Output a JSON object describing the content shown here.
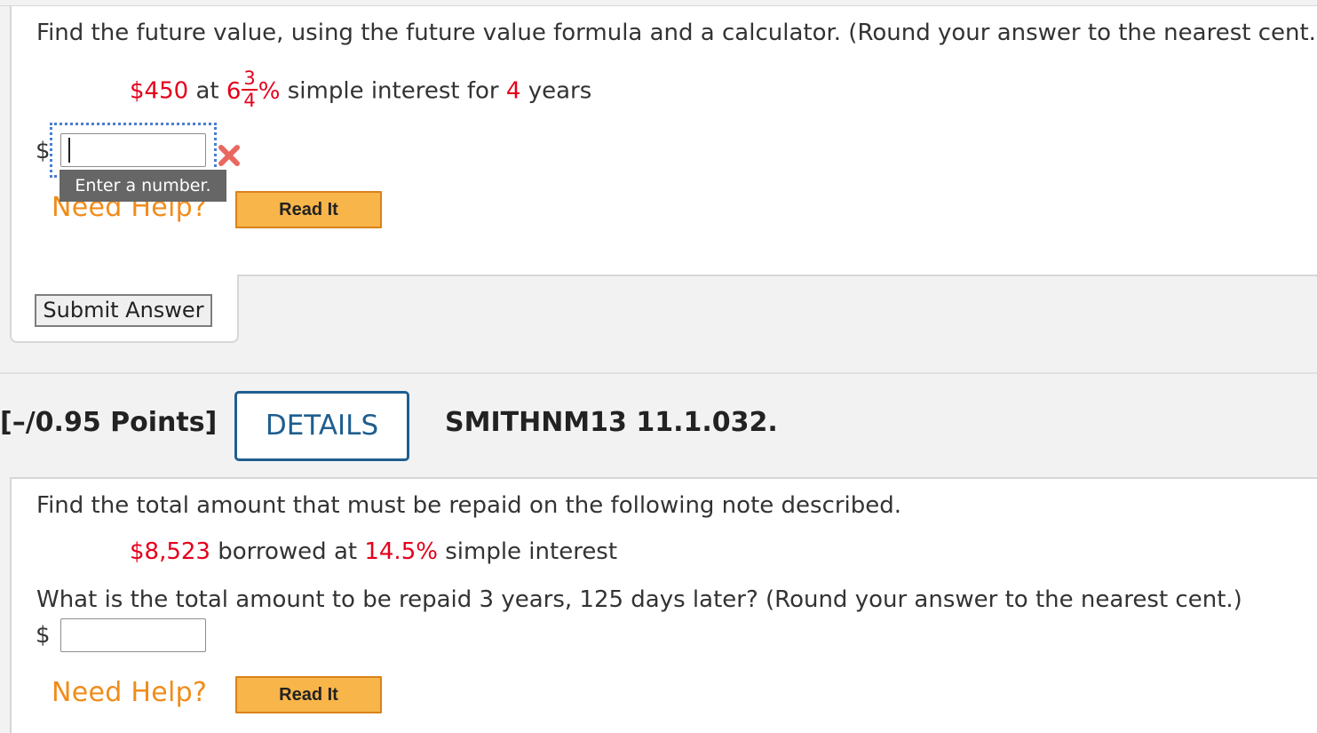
{
  "q1": {
    "prompt": "Find the future value, using the future value formula and a calculator. (Round your answer to the nearest cent.)",
    "principal": "$450",
    "at_word": "at",
    "rate_whole": "6",
    "rate_frac_num": "3",
    "rate_frac_den": "4",
    "rate_percent": "%",
    "simple_interest_for": "simple interest for",
    "years_value": "4",
    "years_word": "years",
    "currency": "$",
    "answer_value": "",
    "tooltip": "Enter a number.",
    "need_help": "Need Help?",
    "read_it": "Read It",
    "submit": "Submit Answer"
  },
  "q2": {
    "points": "[–/0.95 Points]",
    "details": "DETAILS",
    "question_id": "SMITHNM13 11.1.032.",
    "prompt": "Find the total amount that must be repaid on the following note described.",
    "amount": "$8,523",
    "borrowed_at": "borrowed at",
    "rate": "14.5%",
    "simple_interest": "simple interest",
    "question": "What is the total amount to be repaid 3 years, 125 days later? (Round your answer to the nearest cent.)",
    "currency": "$",
    "answer_value": "",
    "need_help": "Need Help?",
    "read_it": "Read It"
  },
  "colors": {
    "highlight_red": "#e4001b",
    "help_orange": "#f08c1a",
    "read_it_bg": "#f8b54a",
    "details_blue": "#1f5e8f",
    "focus_blue": "#4a7ed0",
    "incorrect_mark": "#e8685f"
  }
}
